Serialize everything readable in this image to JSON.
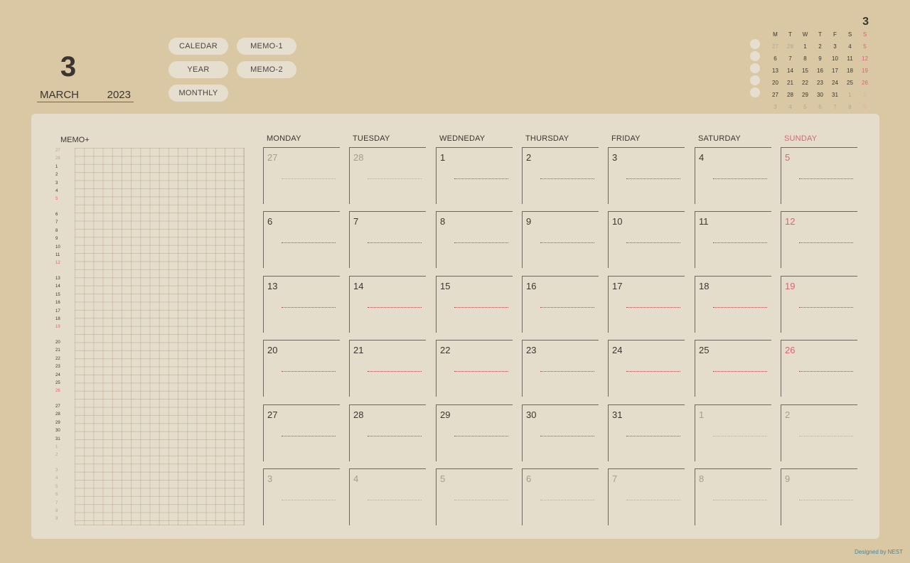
{
  "header": {
    "month_number": "3",
    "month_name": "MARCH",
    "year": "2023"
  },
  "nav": [
    {
      "label": "CALEDAR"
    },
    {
      "label": "MEMO-1"
    },
    {
      "label": "YEAR"
    },
    {
      "label": "MEMO-2"
    },
    {
      "label": "MONTHLY"
    }
  ],
  "mini_calendar": {
    "title": "3",
    "weekdays": [
      "M",
      "T",
      "W",
      "T",
      "F",
      "S",
      "S"
    ],
    "weeks": [
      [
        {
          "d": "27",
          "s": "dim"
        },
        {
          "d": "28",
          "s": "dim"
        },
        {
          "d": "1"
        },
        {
          "d": "2"
        },
        {
          "d": "3"
        },
        {
          "d": "4"
        },
        {
          "d": "5",
          "s": "sun"
        }
      ],
      [
        {
          "d": "6"
        },
        {
          "d": "7"
        },
        {
          "d": "8"
        },
        {
          "d": "9"
        },
        {
          "d": "10"
        },
        {
          "d": "11"
        },
        {
          "d": "12",
          "s": "sun"
        }
      ],
      [
        {
          "d": "13"
        },
        {
          "d": "14"
        },
        {
          "d": "15"
        },
        {
          "d": "16"
        },
        {
          "d": "17"
        },
        {
          "d": "18"
        },
        {
          "d": "19",
          "s": "sun"
        }
      ],
      [
        {
          "d": "20"
        },
        {
          "d": "21"
        },
        {
          "d": "22"
        },
        {
          "d": "23"
        },
        {
          "d": "24"
        },
        {
          "d": "25"
        },
        {
          "d": "26",
          "s": "sun"
        }
      ],
      [
        {
          "d": "27"
        },
        {
          "d": "28"
        },
        {
          "d": "29"
        },
        {
          "d": "30"
        },
        {
          "d": "31"
        },
        {
          "d": "1",
          "s": "dim"
        },
        {
          "d": "2",
          "s": "sundim"
        }
      ],
      [
        {
          "d": "3",
          "s": "dim"
        },
        {
          "d": "4",
          "s": "dim"
        },
        {
          "d": "5",
          "s": "dim"
        },
        {
          "d": "6",
          "s": "dim"
        },
        {
          "d": "7",
          "s": "dim"
        },
        {
          "d": "8",
          "s": "dim"
        },
        {
          "d": "9",
          "s": "sundim"
        }
      ]
    ]
  },
  "memo": {
    "title": "MEMO+",
    "groups": [
      [
        {
          "d": "27",
          "s": "dim"
        },
        {
          "d": "28",
          "s": "dim"
        },
        {
          "d": "1"
        },
        {
          "d": "2"
        },
        {
          "d": "3"
        },
        {
          "d": "4"
        },
        {
          "d": "5",
          "s": "sun"
        }
      ],
      [
        {
          "d": "6"
        },
        {
          "d": "7"
        },
        {
          "d": "8"
        },
        {
          "d": "9"
        },
        {
          "d": "10"
        },
        {
          "d": "11"
        },
        {
          "d": "12",
          "s": "sun"
        }
      ],
      [
        {
          "d": "13"
        },
        {
          "d": "14"
        },
        {
          "d": "15"
        },
        {
          "d": "16"
        },
        {
          "d": "17"
        },
        {
          "d": "18"
        },
        {
          "d": "19",
          "s": "sun"
        }
      ],
      [
        {
          "d": "20"
        },
        {
          "d": "21"
        },
        {
          "d": "22"
        },
        {
          "d": "23"
        },
        {
          "d": "24"
        },
        {
          "d": "25"
        },
        {
          "d": "26",
          "s": "sun"
        }
      ],
      [
        {
          "d": "27"
        },
        {
          "d": "28"
        },
        {
          "d": "29"
        },
        {
          "d": "30"
        },
        {
          "d": "31"
        },
        {
          "d": "1",
          "s": "dim"
        },
        {
          "d": "2",
          "s": "dim"
        }
      ],
      [
        {
          "d": "3",
          "s": "dim"
        },
        {
          "d": "4",
          "s": "dim"
        },
        {
          "d": "5",
          "s": "dim"
        },
        {
          "d": "6",
          "s": "dim"
        },
        {
          "d": "7",
          "s": "dim"
        },
        {
          "d": "8",
          "s": "dim"
        },
        {
          "d": "9",
          "s": "dim"
        }
      ]
    ]
  },
  "weekdays": [
    "MONDAY",
    "TUESDAY",
    "WEDNEDAY",
    "THURSDAY",
    "FRIDAY",
    "SATURDAY",
    "SUNDAY"
  ],
  "weeks": [
    [
      {
        "d": "27",
        "s": "dim"
      },
      {
        "d": "28",
        "s": "dim"
      },
      {
        "d": "1"
      },
      {
        "d": "2"
      },
      {
        "d": "3"
      },
      {
        "d": "4"
      },
      {
        "d": "5",
        "s": "sun"
      }
    ],
    [
      {
        "d": "6"
      },
      {
        "d": "7"
      },
      {
        "d": "8"
      },
      {
        "d": "9"
      },
      {
        "d": "10"
      },
      {
        "d": "11"
      },
      {
        "d": "12",
        "s": "sun"
      }
    ],
    [
      {
        "d": "13"
      },
      {
        "d": "14"
      },
      {
        "d": "15"
      },
      {
        "d": "16"
      },
      {
        "d": "17"
      },
      {
        "d": "18"
      },
      {
        "d": "19",
        "s": "sun"
      }
    ],
    [
      {
        "d": "20"
      },
      {
        "d": "21"
      },
      {
        "d": "22"
      },
      {
        "d": "23"
      },
      {
        "d": "24"
      },
      {
        "d": "25"
      },
      {
        "d": "26",
        "s": "sun"
      }
    ],
    [
      {
        "d": "27"
      },
      {
        "d": "28"
      },
      {
        "d": "29"
      },
      {
        "d": "30"
      },
      {
        "d": "31"
      },
      {
        "d": "1",
        "s": "dim"
      },
      {
        "d": "2",
        "s": "dim"
      }
    ],
    [
      {
        "d": "3",
        "s": "dim"
      },
      {
        "d": "4",
        "s": "dim"
      },
      {
        "d": "5",
        "s": "dim"
      },
      {
        "d": "6",
        "s": "dim"
      },
      {
        "d": "7",
        "s": "dim"
      },
      {
        "d": "8",
        "s": "dim"
      },
      {
        "d": "9",
        "s": "dim"
      }
    ]
  ],
  "footer": {
    "credit": "Designed by NEST"
  },
  "colors": {
    "background": "#d9c8a3",
    "panel": "#e5ddcb",
    "sunday": "#e0607a",
    "dots": "#b54a4a",
    "credit": "#3d8aa0"
  }
}
